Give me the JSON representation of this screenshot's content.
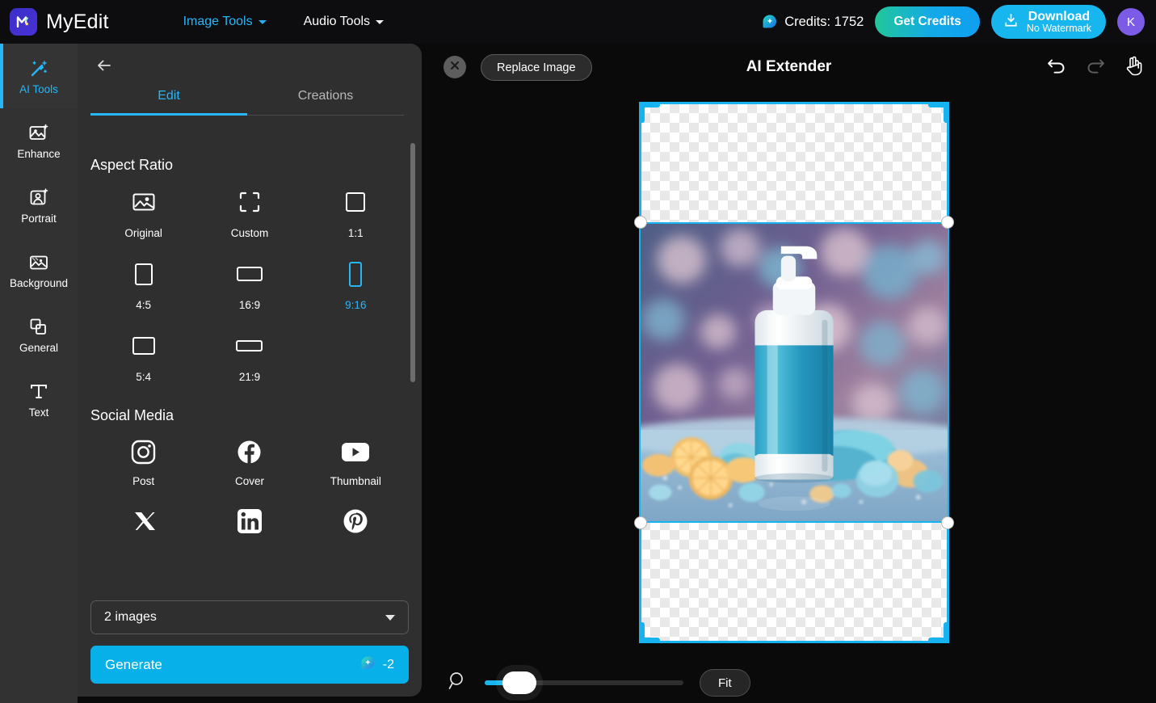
{
  "header": {
    "logo_icon": "myedit-logo-icon",
    "brand": "MyEdit",
    "nav": [
      {
        "label": "Image Tools",
        "icon": "chevron-down-icon",
        "accent": true
      },
      {
        "label": "Audio Tools",
        "icon": "chevron-down-icon",
        "accent": false
      }
    ],
    "credits_icon": "credit-gem-icon",
    "credits_label": "Credits: 1752",
    "get_credits_label": "Get Credits",
    "download_icon": "download-icon",
    "download_label": "Download",
    "download_sub": "No Watermark",
    "avatar_initial": "K"
  },
  "rail": {
    "items": [
      {
        "label": "AI Tools",
        "icon": "magic-wand-icon",
        "active": true
      },
      {
        "label": "Enhance",
        "icon": "image-sparkle-icon",
        "active": false
      },
      {
        "label": "Portrait",
        "icon": "portrait-person-icon",
        "active": false
      },
      {
        "label": "Background",
        "icon": "background-image-icon",
        "active": false
      },
      {
        "label": "General",
        "icon": "layers-copy-icon",
        "active": false
      },
      {
        "label": "Text",
        "icon": "text-t-icon",
        "active": false
      }
    ]
  },
  "panel": {
    "back_icon": "arrow-left-icon",
    "tabs": [
      {
        "label": "Edit",
        "active": true
      },
      {
        "label": "Creations",
        "active": false
      }
    ],
    "aspect_ratio": {
      "title": "Aspect Ratio",
      "items": [
        {
          "label": "Original",
          "icon": "image-original-icon",
          "selected": false
        },
        {
          "label": "Custom",
          "icon": "custom-crop-icon",
          "selected": false
        },
        {
          "label": "1:1",
          "icon": "square-icon",
          "selected": false
        },
        {
          "label": "4:5",
          "icon": "portrait-rect-icon",
          "selected": false
        },
        {
          "label": "16:9",
          "icon": "wide-rect-icon",
          "selected": false
        },
        {
          "label": "9:16",
          "icon": "tall-rect-icon",
          "selected": true
        },
        {
          "label": "5:4",
          "icon": "landscape-rect-icon",
          "selected": false
        },
        {
          "label": "21:9",
          "icon": "ultrawide-rect-icon",
          "selected": false
        }
      ]
    },
    "social_media": {
      "title": "Social Media",
      "items": [
        {
          "label": "Post",
          "icon": "instagram-icon"
        },
        {
          "label": "Cover",
          "icon": "facebook-icon"
        },
        {
          "label": "Thumbnail",
          "icon": "youtube-icon"
        },
        {
          "label": "",
          "icon": "x-twitter-icon"
        },
        {
          "label": "",
          "icon": "linkedin-icon"
        },
        {
          "label": "",
          "icon": "pinterest-icon"
        }
      ]
    },
    "image_count_value": "2 images",
    "image_count_caret": "chevron-down-icon",
    "generate_label": "Generate",
    "generate_cost": "-2",
    "generate_cost_icon": "credit-gem-icon",
    "collapse_icon": "chevron-left-icon"
  },
  "canvas": {
    "close_icon": "close-x-icon",
    "replace_label": "Replace Image",
    "title": "AI Extender",
    "tools": [
      {
        "icon": "undo-icon",
        "enabled": true
      },
      {
        "icon": "redo-icon",
        "enabled": false
      },
      {
        "icon": "hand-pan-icon",
        "enabled": true
      }
    ],
    "zoom_icon": "magnifier-icon",
    "fit_label": "Fit"
  },
  "colors": {
    "accent": "#29b6f6",
    "frame": "#16b3f0",
    "generate": "#07b0e8",
    "avatar": "#7c5ce6",
    "panel_bg": "#2f2f2f",
    "rail_bg": "#323232"
  }
}
